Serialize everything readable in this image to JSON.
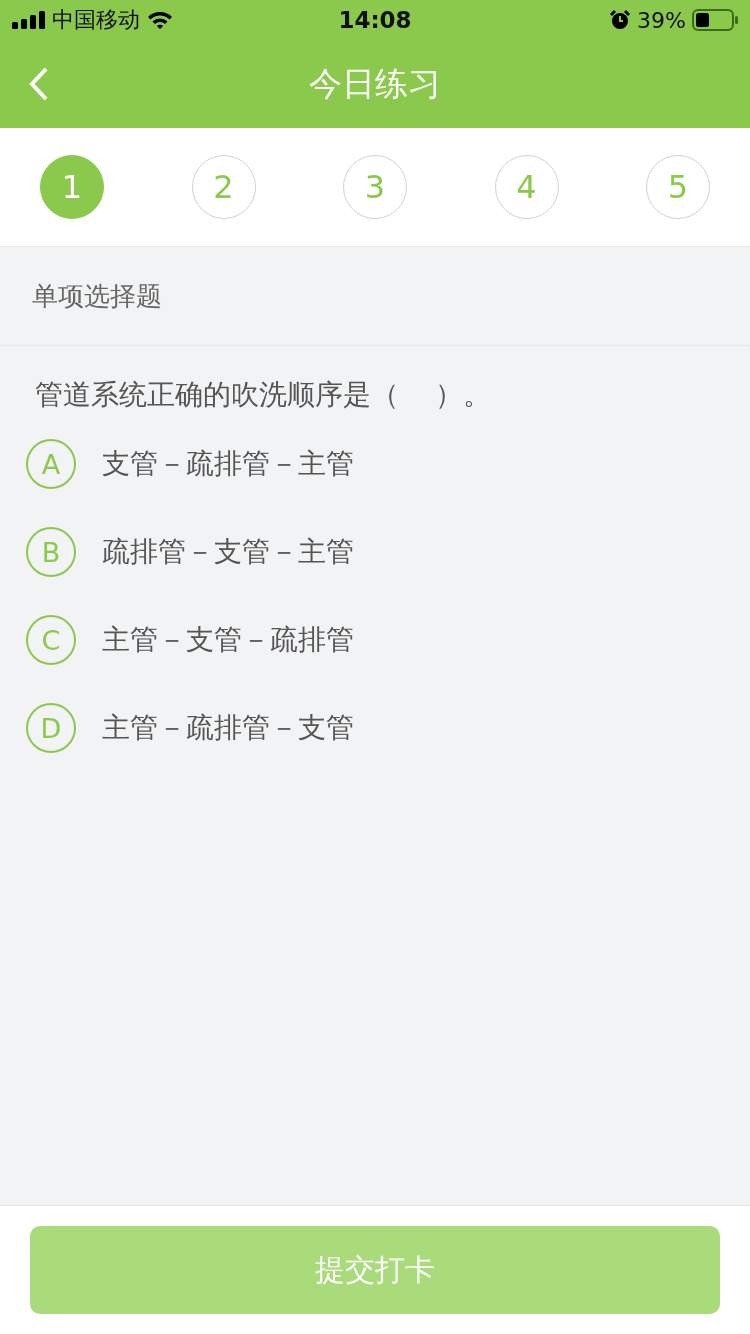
{
  "status_bar": {
    "carrier": "中国移动",
    "time": "14:08",
    "battery": "39%"
  },
  "nav": {
    "title": "今日练习"
  },
  "steps": [
    {
      "label": "1",
      "selected": true
    },
    {
      "label": "2",
      "selected": false
    },
    {
      "label": "3",
      "selected": false
    },
    {
      "label": "4",
      "selected": false
    },
    {
      "label": "5",
      "selected": false
    }
  ],
  "question": {
    "type_label": "单项选择题",
    "text": "管道系统正确的吹洗顺序是（    ）。",
    "options": [
      {
        "letter": "A",
        "text": "支管－疏排管－主管",
        "selected": false
      },
      {
        "letter": "B",
        "text": "疏排管－支管－主管",
        "selected": false
      },
      {
        "letter": "C",
        "text": "主管－支管－疏排管",
        "selected": false
      },
      {
        "letter": "D",
        "text": "主管－疏排管－支管",
        "selected": false
      }
    ]
  },
  "submit_button": {
    "label": "提交打卡",
    "disabled": true
  }
}
